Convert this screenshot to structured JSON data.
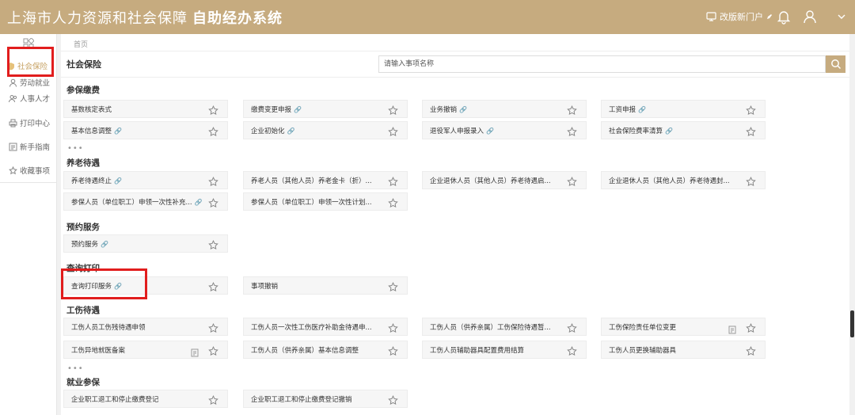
{
  "header": {
    "title": "上海市人力资源和社会保障",
    "subtitle": "自助经办系统",
    "portal_label": "改版新门户"
  },
  "sidebar": {
    "items": [
      {
        "label": "社会保险",
        "icon": "shield-icon",
        "active": true
      },
      {
        "label": "劳动就业",
        "icon": "person-icon"
      },
      {
        "label": "人事人才",
        "icon": "people-icon"
      },
      {
        "label": "打印中心",
        "icon": "printer-icon"
      },
      {
        "label": "新手指南",
        "icon": "guide-icon"
      },
      {
        "label": "收藏事项",
        "icon": "star-icon"
      }
    ]
  },
  "breadcrumb": "首页",
  "main": {
    "title": "社会保险",
    "search_placeholder": "请输入事项名称"
  },
  "sections": [
    {
      "title": "参保缴费",
      "rows": [
        [
          "基数核定表式",
          "缴费变更申报",
          "业务撤销",
          "工资申报"
        ],
        [
          "基本信息调整",
          "企业初始化",
          "退役军人申报录入",
          "社会保险费率清算"
        ]
      ],
      "more": "•••"
    },
    {
      "title": "养老待遇",
      "rows": [
        [
          "养老待遇终止",
          "养老人员（其他人员）养老金卡（折）...",
          "企业退休人员（其他人员）养老待遇启...",
          "企业退休人员（其他人员）养老待遇封..."
        ],
        [
          "参保人员（单位职工）申领一次性补充...",
          "参保人员（单位职工）申领一次性计划..."
        ]
      ]
    },
    {
      "title": "预约服务",
      "rows": [
        [
          "预约服务"
        ]
      ]
    },
    {
      "title": "查询打印",
      "rows": [
        [
          "查询打印服务",
          "事项撤销"
        ]
      ]
    },
    {
      "title": "工伤待遇",
      "rows": [
        [
          "工伤人员工伤残待遇申领",
          "工伤人员一次性工伤医疗补助金待遇申...",
          "工伤人员（供养亲属）工伤保险待遇暂...",
          "工伤保险责任单位变更"
        ],
        [
          "工伤异地就医备案",
          "工伤人员（供养亲属）基本信息调整",
          "工伤人员辅助器具配置费用结算",
          "工伤人员更换辅助器具"
        ]
      ],
      "more": "•••"
    },
    {
      "title": "就业参保",
      "rows": [
        [
          "企业职工退工和停止缴费登记",
          "企业职工退工和停止缴费登记撤销"
        ]
      ]
    }
  ],
  "colors": {
    "header": "#c6ab7f",
    "highlight": "#e11d1d",
    "accent": "#c6a060"
  }
}
